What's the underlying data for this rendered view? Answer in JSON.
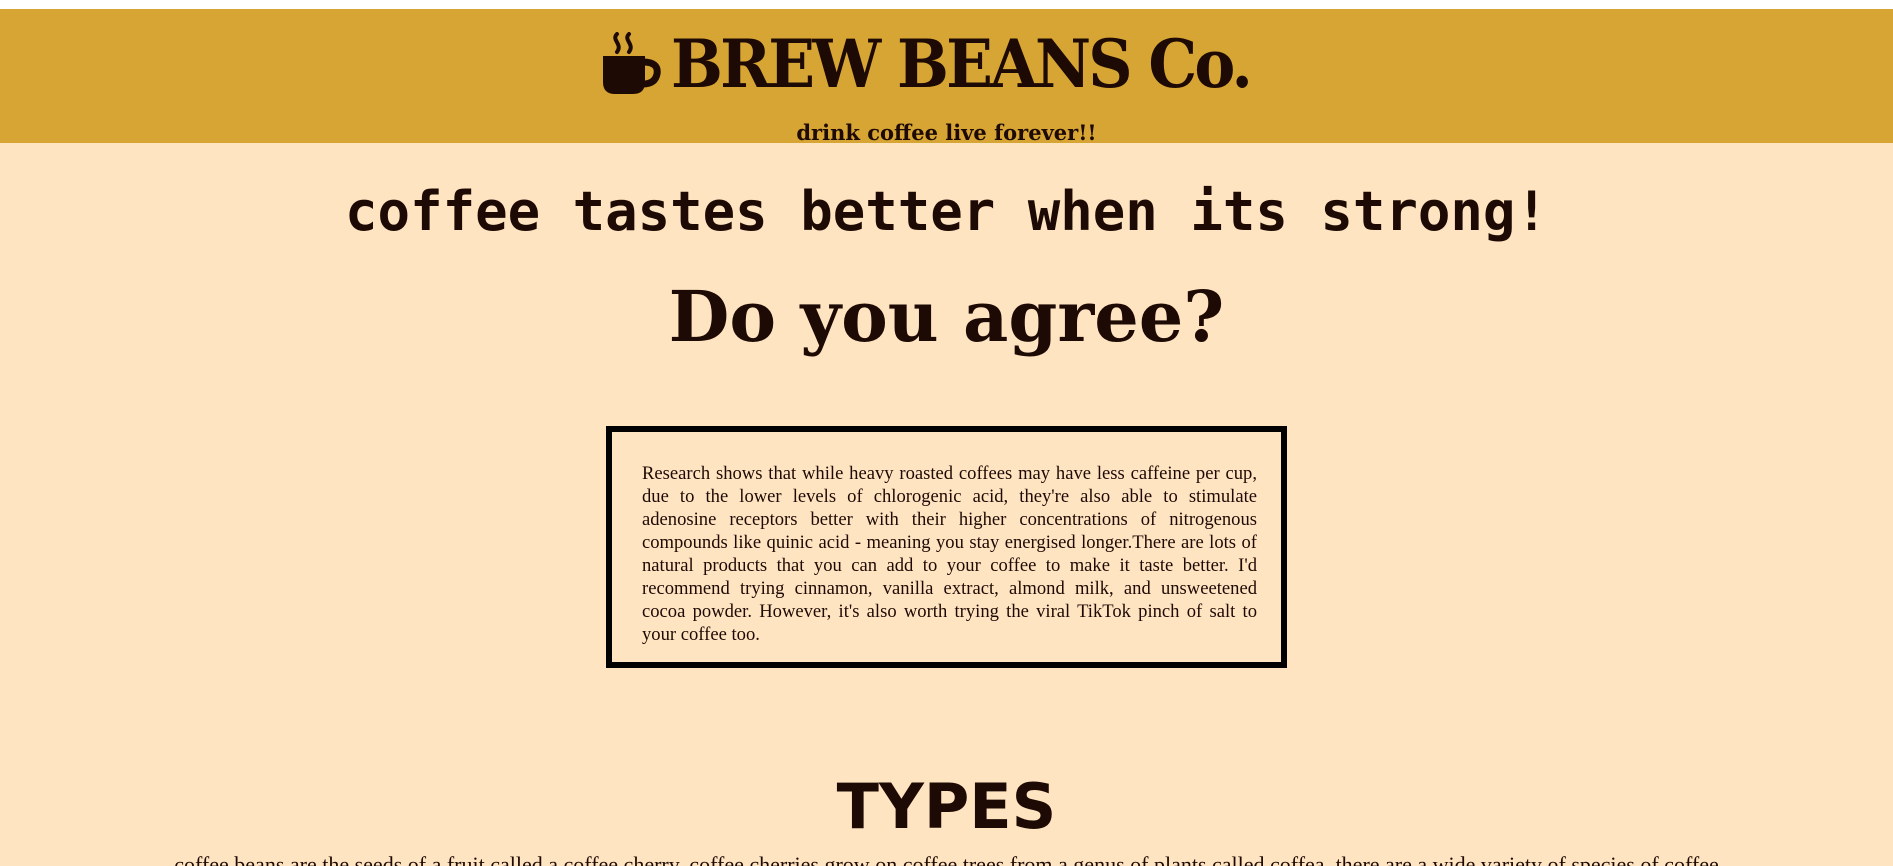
{
  "header": {
    "brand_title": "BREW BEANS Co.",
    "tagline": "drink coffee live forever!!",
    "brand_icon": "coffee-cup-icon",
    "background_color": "#d7a533"
  },
  "main": {
    "headline": "coffee tastes better when its strong!",
    "question": "Do you agree?",
    "info_text": "Research shows that while heavy roasted coffees may have less caffeine per cup, due to the lower levels of chlorogenic acid, they're also able to stimulate adenosine receptors better with their higher concentrations of nitrogenous compounds like quinic acid - meaning you stay energised longer.There are lots of natural products that you can add to your coffee to make it taste better. I'd recommend trying cinnamon, vanilla extract, almond milk, and unsweetened cocoa powder. However, it's also worth trying the viral TikTok pinch of salt to your coffee too."
  },
  "types": {
    "heading": "TYPES",
    "text": "coffee beans are the seeds of a fruit called a coffee cherry. coffee cherries grow on coffee trees from a genus of plants called coffea. there are a wide variety of species of coffee"
  },
  "colors": {
    "page_background": "#ffe4c2",
    "text": "#1e0a04",
    "box_border": "#000000"
  }
}
